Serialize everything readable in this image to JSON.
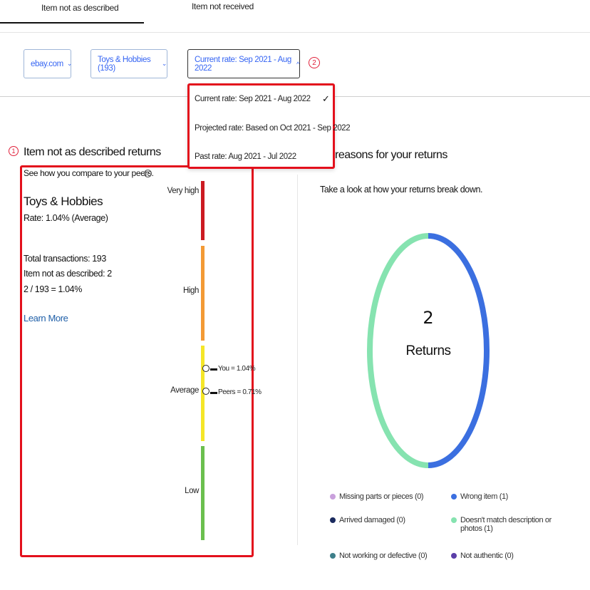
{
  "tabs": [
    {
      "label": "Item not as described"
    },
    {
      "label": "Item not received"
    }
  ],
  "filters": {
    "site": "ebay.com",
    "category": "Toys & Hobbies (193)",
    "rate": "Current rate: Sep 2021 - Aug 2022"
  },
  "dropdown": {
    "options": [
      "Current rate: Sep 2021 - Aug 2022",
      "Projected rate: Based on Oct 2021 - Sep 2022",
      "Past rate: Aug 2021 - Jul 2022"
    ],
    "check": "✓"
  },
  "annotations": {
    "badge1": "1",
    "badge2": "2"
  },
  "left": {
    "title": "Item not as described returns",
    "peers_text": "See how you compare to your peers.",
    "info": "i",
    "category": "Toys & Hobbies",
    "rate": "Rate: 1.04% (Average)",
    "stats": [
      "Total transactions: 193",
      "Item not as described: 2",
      "2 / 193 = 1.04%"
    ],
    "learn_more": "Learn More",
    "scale": [
      "Very high",
      "High",
      "Average",
      "Low"
    ],
    "markers": {
      "you": "You = 1.04%",
      "peers": "Peers = 0.71%"
    }
  },
  "right": {
    "title": "reasons for your returns",
    "subtitle": "Take a look at how your returns break down.",
    "total": "2",
    "total_label": "Returns",
    "legend": [
      {
        "label": "Missing parts or pieces (0)",
        "color": "#c9a0dc"
      },
      {
        "label": "Wrong item (1)",
        "color": "#3b6fe0"
      },
      {
        "label": "Arrived damaged (0)",
        "color": "#1a2a5e"
      },
      {
        "label": "Doesn't match description or photos (1)",
        "color": "#86e3b0"
      },
      {
        "label": "Not working or defective (0)",
        "color": "#3e7f8a"
      },
      {
        "label": "Not authentic (0)",
        "color": "#5b3fa8"
      }
    ]
  },
  "chart_data": {
    "type": "pie",
    "categories": [
      "Wrong item",
      "Doesn't match description or photos"
    ],
    "values": [
      1,
      1
    ]
  }
}
